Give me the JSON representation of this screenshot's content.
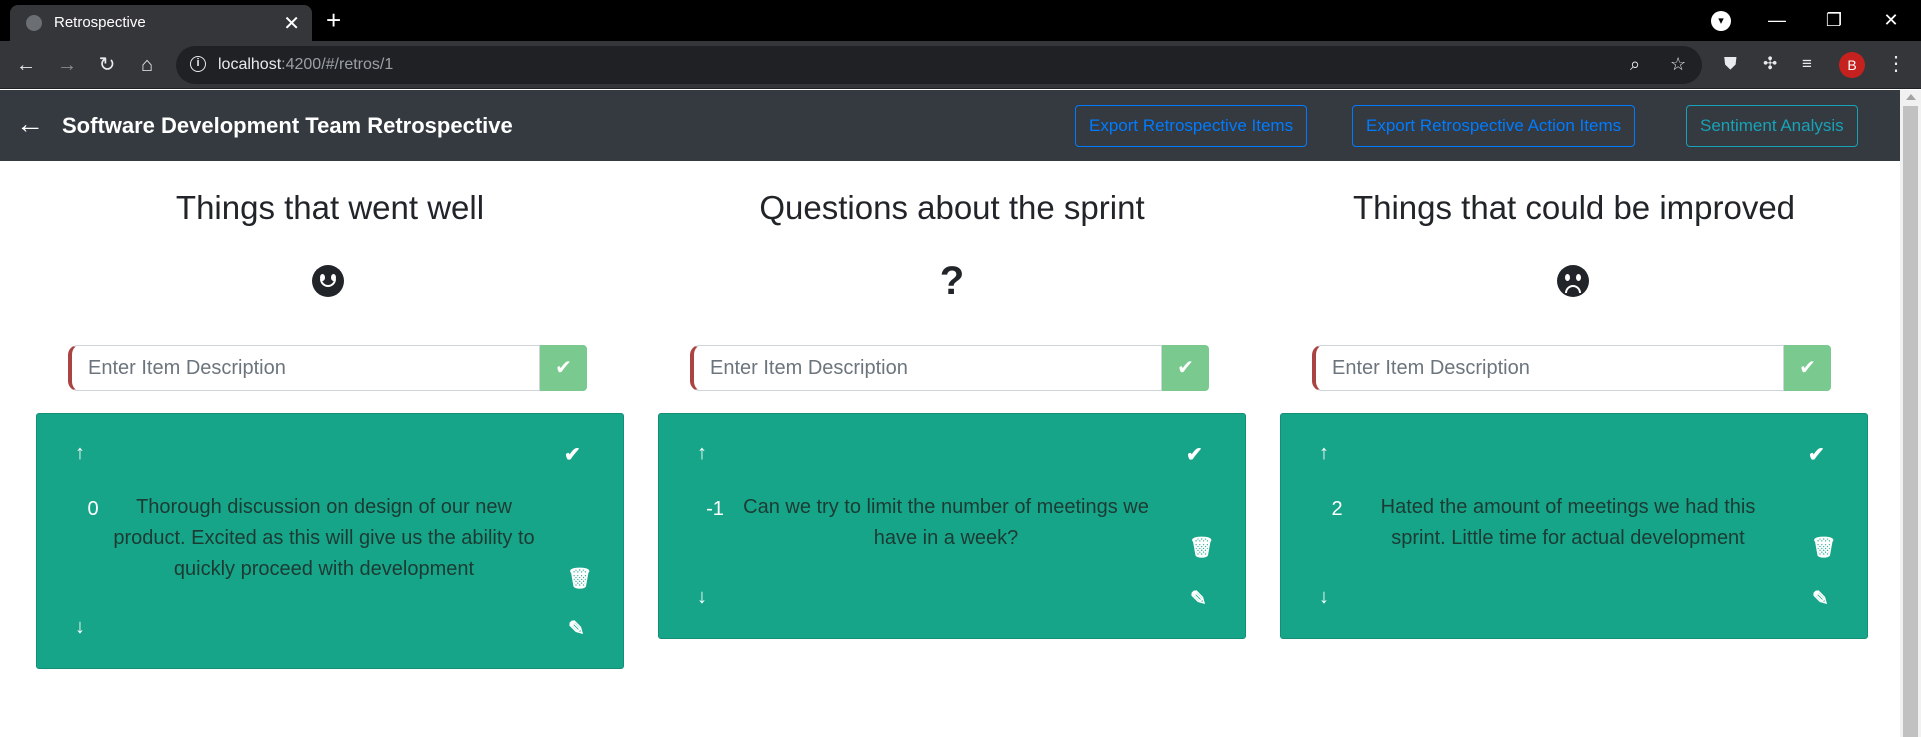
{
  "browser": {
    "tab_title": "Retrospective",
    "url_host": "localhost",
    "url_path": ":4200/#/retros/1",
    "profile_initial": "B"
  },
  "header": {
    "title": "Software Development Team Retrospective",
    "buttons": {
      "export_items": "Export Retrospective Items",
      "export_actions": "Export Retrospective Action Items",
      "sentiment": "Sentiment Analysis"
    }
  },
  "columns": [
    {
      "title": "Things that went well",
      "icon": "smile-icon",
      "input_placeholder": "Enter Item Description",
      "items": [
        {
          "score": "0",
          "description": "Thorough discussion on design of our new product. Excited as this will give us the ability to quickly proceed with development"
        }
      ]
    },
    {
      "title": "Questions about the sprint",
      "icon": "question-icon",
      "icon_glyph": "?",
      "input_placeholder": "Enter Item Description",
      "items": [
        {
          "score": "-1",
          "description": "Can we try to limit the number of meetings we have in a week?"
        }
      ]
    },
    {
      "title": "Things that could be improved",
      "icon": "frown-icon",
      "input_placeholder": "Enter Item Description",
      "items": [
        {
          "score": "2",
          "description": "Hated the amount of meetings we had this sprint. Little time for actual development"
        }
      ]
    }
  ],
  "colors": {
    "header_bg": "#343a40",
    "card_bg": "#17a589",
    "submit_green": "#7ac98f",
    "primary": "#007bff",
    "info": "#17a2b8"
  }
}
